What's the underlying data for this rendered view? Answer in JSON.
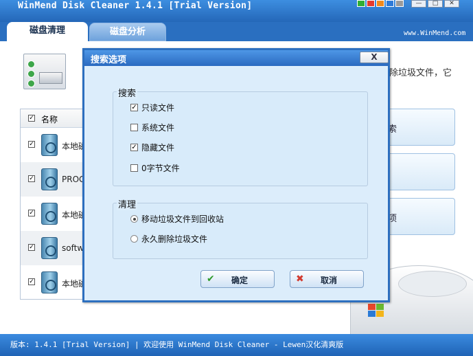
{
  "app": {
    "title": "WinMend Disk Cleaner 1.4.1 [Trial Version]",
    "url": "www.WinMend.com",
    "skin_colors": [
      "#2fae35",
      "#e43b2f",
      "#f08a1d",
      "#2d7ad8",
      "#9b9b9b"
    ],
    "window_buttons": {
      "minimize": "—",
      "restore": "□",
      "close": "✕"
    }
  },
  "tabs": [
    {
      "label": "磁盘清理",
      "active": true
    },
    {
      "label": "磁盘分析",
      "active": false
    }
  ],
  "main": {
    "description_fragment": "除垃圾文件，它",
    "list": {
      "header_label": "名称",
      "rows": [
        {
          "label": "本地磁",
          "checked": true
        },
        {
          "label": "PROGR",
          "checked": true
        },
        {
          "label": "本地磁",
          "checked": true
        },
        {
          "label": "softwa",
          "checked": true
        },
        {
          "label": "本地磁",
          "checked": true
        }
      ]
    },
    "side_buttons": [
      {
        "label": "索"
      },
      {
        "label": ""
      },
      {
        "label": "项"
      }
    ]
  },
  "dialog": {
    "title": "搜索选项",
    "close_label": "X",
    "search_group": {
      "label": "搜索",
      "options": [
        {
          "label": "只读文件",
          "checked": true
        },
        {
          "label": "系统文件",
          "checked": false
        },
        {
          "label": "隐藏文件",
          "checked": true
        },
        {
          "label": "0字节文件",
          "checked": false
        }
      ]
    },
    "clean_group": {
      "label": "清理",
      "options": [
        {
          "label": "移动垃圾文件到回收站",
          "selected": true
        },
        {
          "label": "永久删除垃圾文件",
          "selected": false
        }
      ]
    },
    "ok_button": {
      "label": "确定",
      "icon": "check-icon"
    },
    "cancel_button": {
      "label": "取消",
      "icon": "cross-icon"
    }
  },
  "status": {
    "text": "版本: 1.4.1 [Trial Version]   |   欢迎使用 WinMend Disk Cleaner - Lewen汉化清爽版"
  }
}
